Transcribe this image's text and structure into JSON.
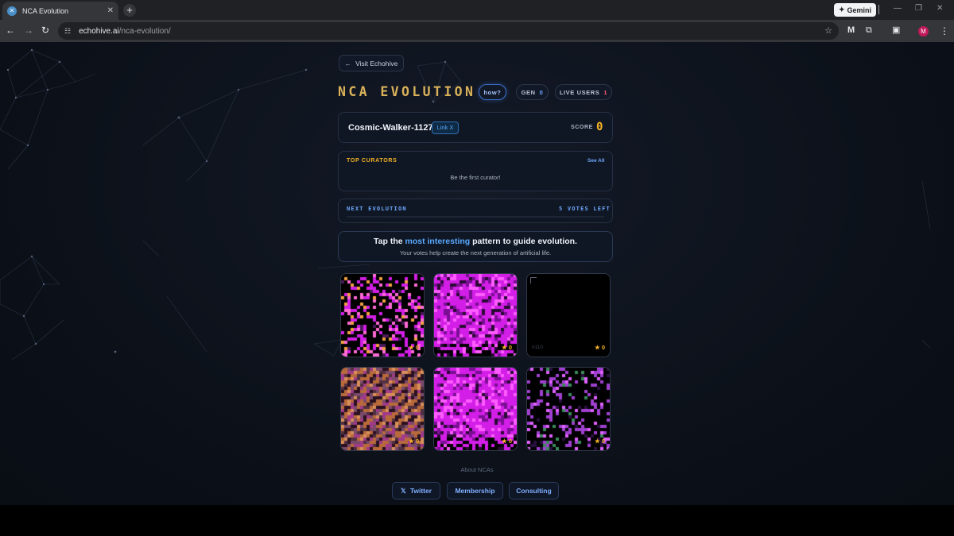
{
  "browser": {
    "tab_title": "NCA Evolution",
    "tab_close": "✕",
    "new_tab": "+",
    "gemini_label": "Gemini",
    "url_host": "echohive.ai",
    "url_path": "/nca-evolution/",
    "profile_initial": "M"
  },
  "page": {
    "visit_label": "Visit Echohive",
    "brand": "NCA EVOLUTION",
    "how_label": "how?",
    "gen_label": "GEN",
    "gen_value": "0",
    "live_label": "LIVE USERS",
    "live_value": "1"
  },
  "user": {
    "name": "Cosmic-Walker-1127",
    "link_label": "Link X",
    "score_label": "SCORE",
    "score_value": "0"
  },
  "curators": {
    "title": "TOP CURATORS",
    "see_all": "See All",
    "empty_text": "Be the first curator!"
  },
  "evolution": {
    "label": "NEXT EVOLUTION",
    "votes_left": "5 VOTES LEFT",
    "progress": 0
  },
  "prompt": {
    "pre": "Tap the ",
    "highlight": "most interesting",
    "post": " pattern to guide evolution.",
    "sub": "Your votes help create the next generation of artificial life."
  },
  "patterns": [
    {
      "id": "",
      "stars": "★ 0",
      "style": "sparse-magenta"
    },
    {
      "id": "",
      "stars": "★ 0",
      "style": "dense-magenta"
    },
    {
      "id": "#110",
      "stars": "★ 0",
      "style": "black"
    },
    {
      "id": "",
      "stars": "★ 0",
      "style": "diagonal-orange"
    },
    {
      "id": "",
      "stars": "★ 0",
      "style": "dense-magenta"
    },
    {
      "id": "",
      "stars": "★ 0",
      "style": "sparse-purple"
    }
  ],
  "footer": {
    "about": "About NCAs",
    "twitter": "Twitter",
    "twitter_icon": "𝕏",
    "membership": "Membership",
    "consulting": "Consulting"
  }
}
